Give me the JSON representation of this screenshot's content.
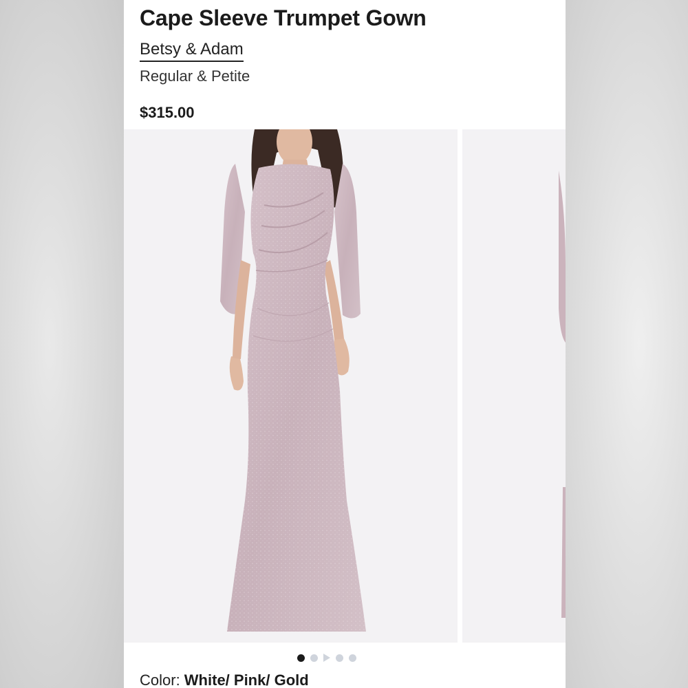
{
  "product": {
    "title": "Cape Sleeve Trumpet Gown",
    "brand": "Betsy & Adam",
    "fit": "Regular & Petite",
    "price": "$315.00",
    "color_label": "Color:",
    "color_value": "White/ Pink/ Gold"
  },
  "gallery": {
    "slide_count": 5,
    "active_index": 0,
    "dress_color": "#cdb6bf",
    "background_color": "#f3f2f4"
  }
}
